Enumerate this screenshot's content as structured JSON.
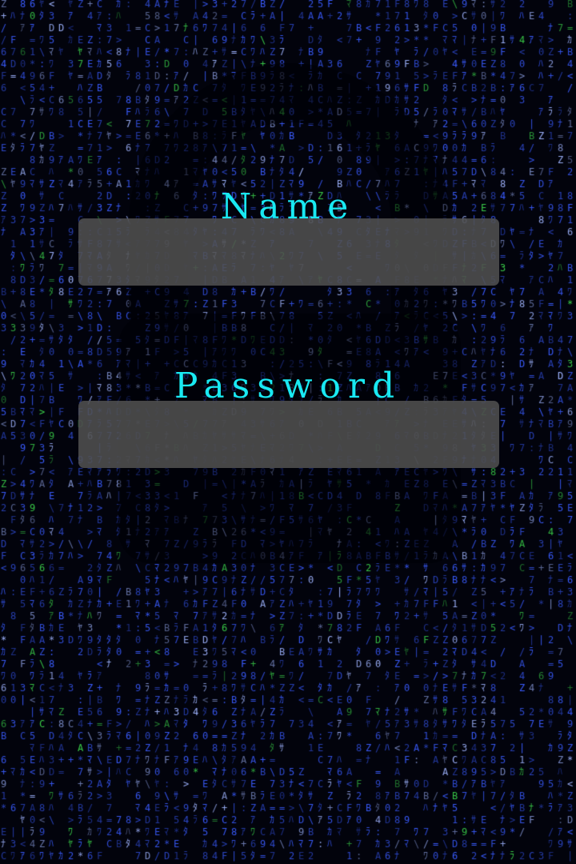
{
  "login_form": {
    "name_label": "Name",
    "name_value": "",
    "password_label": "Password",
    "password_value": ""
  },
  "background": {
    "theme": "matrix-code-rain",
    "watermark_icon": "padlock-icon",
    "colors": {
      "base": "#02030c",
      "code_blue": "#3a5cff",
      "code_highlight": "#9fb4ff",
      "code_green": "#3bd14a",
      "label_cyan": "#19e9f2",
      "field_gray": "#505050"
    }
  }
}
